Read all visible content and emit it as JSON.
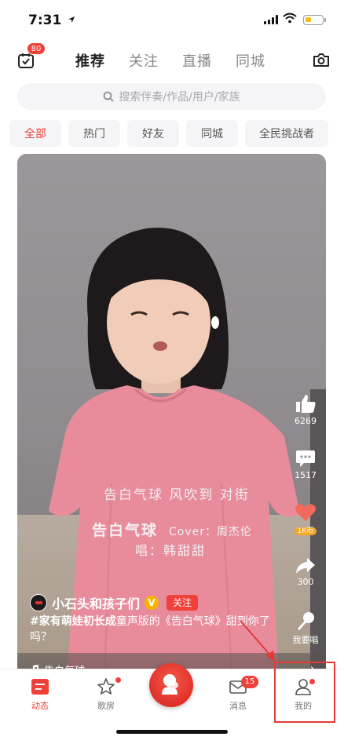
{
  "status_bar": {
    "time": "7:31"
  },
  "top_nav": {
    "calendar_badge": "80",
    "tabs": [
      "推荐",
      "关注",
      "直播",
      "同城"
    ],
    "active_tab": 0
  },
  "search": {
    "placeholder": "搜索伴奏/作品/用户/家族"
  },
  "chips": [
    "全部",
    "热门",
    "好友",
    "同城",
    "全民挑战者"
  ],
  "video": {
    "lyrics": {
      "line1": "告白气球 风吹到 对街",
      "line2_title": "告白气球",
      "line2_cover": "Cover：周杰伦",
      "line3": "唱：韩甜甜"
    },
    "actions": {
      "likes": "6269",
      "comments": "1517",
      "gift": "1K币",
      "shares": "300",
      "sing": "我要唱"
    },
    "author": {
      "name": "小石头和孩子们",
      "verified": "V",
      "follow_label": "关注"
    },
    "description": {
      "tag": "#家有萌娃初长成",
      "text": "童声版的《告白气球》甜到你了吗？"
    },
    "song": "告白气球"
  },
  "bottom_nav": {
    "items": [
      {
        "label": "动态",
        "icon": "feed-icon"
      },
      {
        "label": "歌房",
        "icon": "star-icon"
      },
      {
        "label": "",
        "icon": "sing-center-icon"
      },
      {
        "label": "消息",
        "icon": "mail-icon",
        "badge": "15"
      },
      {
        "label": "我的",
        "icon": "profile-icon"
      }
    ]
  },
  "colors": {
    "accent": "#f0403a",
    "verified": "#f5b400"
  }
}
